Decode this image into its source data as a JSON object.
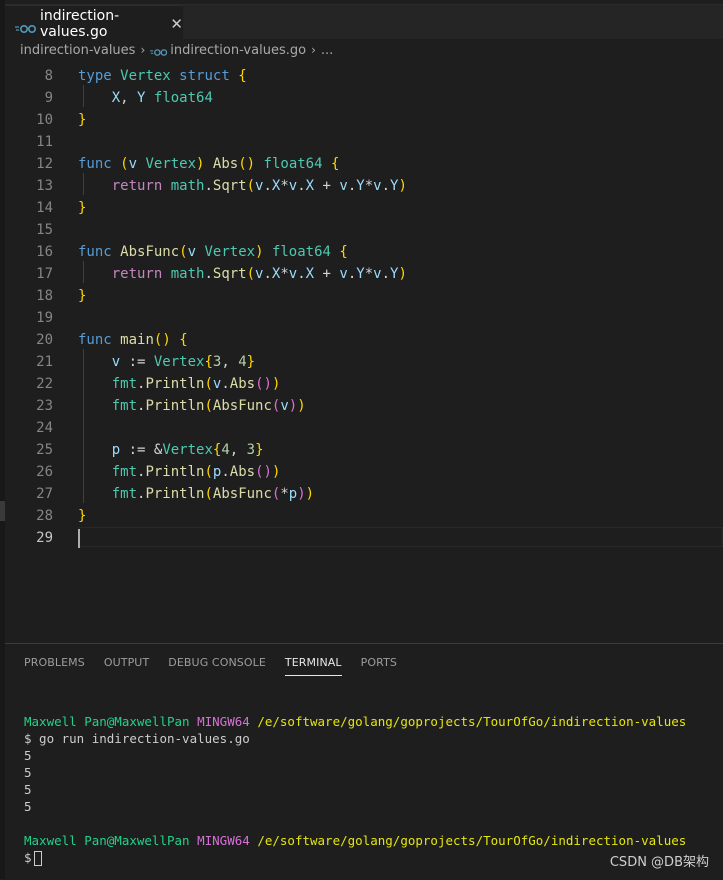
{
  "colors": {
    "background": "#1e1e1e",
    "keyword": "#569cd6",
    "type": "#4ec9b0",
    "function": "#dcdcaa",
    "variable": "#9cdcfe",
    "number": "#b5cea8",
    "control_keyword": "#c586c0",
    "terminal_green": "#23d18b",
    "terminal_magenta": "#d670d6",
    "terminal_yellow": "#e5e510"
  },
  "tab": {
    "icon": "go-file-icon",
    "filename": "indirection-values.go",
    "close": "✕"
  },
  "breadcrumb": {
    "folder": "indirection-values",
    "sep1": "›",
    "file": "indirection-values.go",
    "sep2": "›",
    "more": "..."
  },
  "editor": {
    "line_numbers": [
      "8",
      "9",
      "10",
      "11",
      "12",
      "13",
      "14",
      "15",
      "16",
      "17",
      "18",
      "19",
      "20",
      "21",
      "22",
      "23",
      "24",
      "25",
      "26",
      "27",
      "28",
      "29"
    ],
    "lines": [
      "type Vertex struct {",
      "    X, Y float64",
      "}",
      "",
      "func (v Vertex) Abs() float64 {",
      "    return math.Sqrt(v.X*v.X + v.Y*v.Y)",
      "}",
      "",
      "func AbsFunc(v Vertex) float64 {",
      "    return math.Sqrt(v.X*v.X + v.Y*v.Y)",
      "}",
      "",
      "func main() {",
      "    v := Vertex{3, 4}",
      "    fmt.Println(v.Abs())",
      "    fmt.Println(AbsFunc(v))",
      "",
      "    p := &Vertex{4, 3}",
      "    fmt.Println(p.Abs())",
      "    fmt.Println(AbsFunc(*p))",
      "}",
      ""
    ],
    "active_line": "29"
  },
  "panel": {
    "tabs": [
      "PROBLEMS",
      "OUTPUT",
      "DEBUG CONSOLE",
      "TERMINAL",
      "PORTS"
    ],
    "active_tab": "TERMINAL"
  },
  "terminal": {
    "prompt_user": "Maxwell Pan@MaxwellPan",
    "prompt_host": "MINGW64",
    "prompt_path": "/e/software/golang/goprojects/TourOfGo/indirection-values",
    "command": "$ go run indirection-values.go",
    "outputs": [
      "5",
      "5",
      "5",
      "5"
    ],
    "prompt2_user": "Maxwell Pan@MaxwellPan",
    "prompt2_host": "MINGW64",
    "prompt2_path": "/e/software/golang/goprojects/TourOfGo/indirection-values",
    "dollar": "$"
  },
  "watermark": "CSDN @DB架构"
}
